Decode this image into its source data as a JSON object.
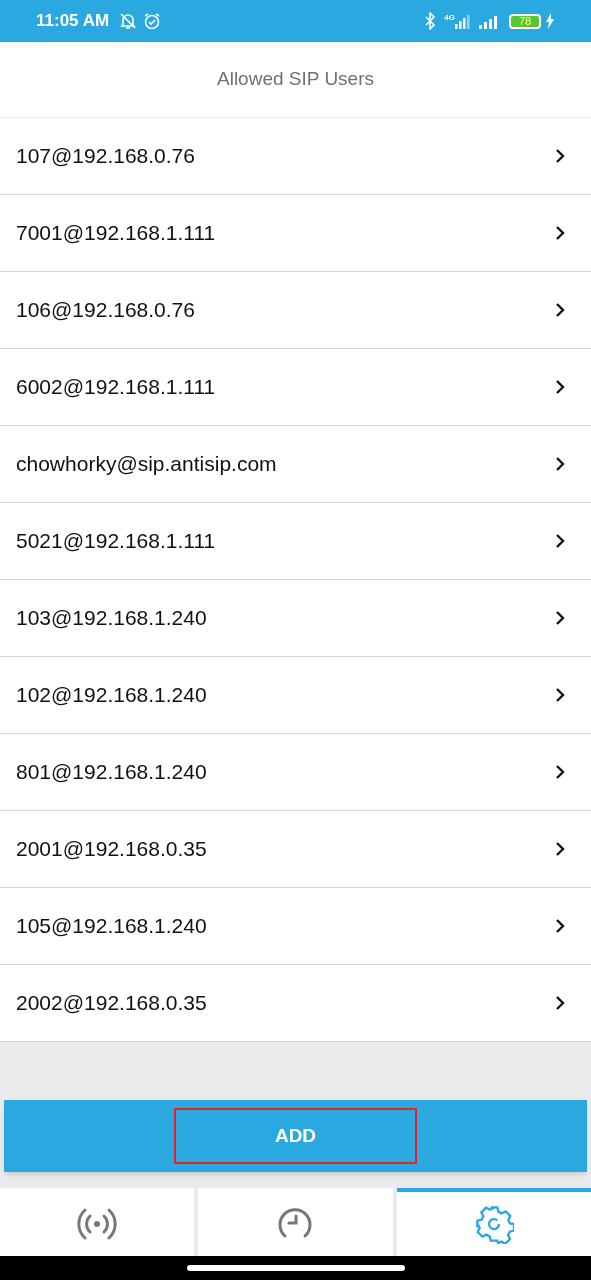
{
  "status_bar": {
    "time": "11:05 AM",
    "network": "4G",
    "battery": "78"
  },
  "header": {
    "title": "Allowed SIP Users"
  },
  "users": [
    {
      "label": "107@192.168.0.76"
    },
    {
      "label": "7001@192.168.1.111"
    },
    {
      "label": "106@192.168.0.76"
    },
    {
      "label": "6002@192.168.1.111"
    },
    {
      "label": "chowhorky@sip.antisip.com"
    },
    {
      "label": "5021@192.168.1.111"
    },
    {
      "label": "103@192.168.1.240"
    },
    {
      "label": "102@192.168.1.240"
    },
    {
      "label": "801@192.168.1.240"
    },
    {
      "label": "2001@192.168.0.35"
    },
    {
      "label": "105@192.168.1.240"
    },
    {
      "label": "2002@192.168.0.35"
    }
  ],
  "add_button": {
    "label": "ADD",
    "highlighted": true
  },
  "tabs": [
    {
      "kind": "broadcast",
      "selected": false
    },
    {
      "kind": "clock",
      "selected": false
    },
    {
      "kind": "settings",
      "selected": true
    }
  ]
}
